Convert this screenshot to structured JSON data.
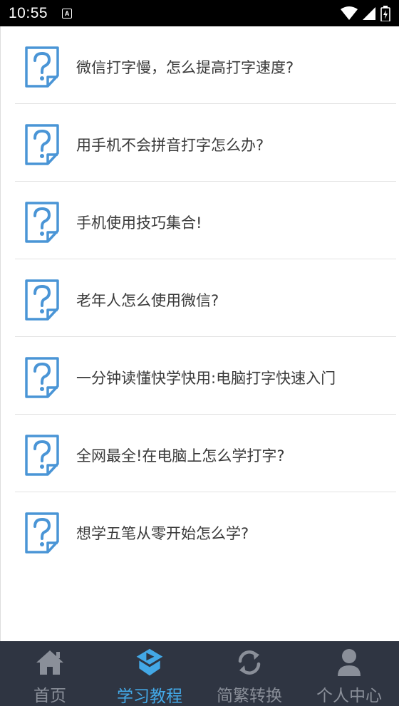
{
  "status_bar": {
    "time": "10:55",
    "notification_glyph": "A",
    "icons": [
      "wifi-icon",
      "cell-signal-icon",
      "battery-icon"
    ]
  },
  "list": {
    "items": [
      {
        "title": "微信打字慢，怎么提高打字速度?",
        "icon": "question-doc-icon"
      },
      {
        "title": "用手机不会拼音打字怎么办?",
        "icon": "question-doc-icon"
      },
      {
        "title": "手机使用技巧集合!",
        "icon": "question-doc-icon"
      },
      {
        "title": "老年人怎么使用微信?",
        "icon": "question-doc-icon"
      },
      {
        "title": "一分钟读懂快学快用:电脑打字快速入门",
        "icon": "question-doc-icon"
      },
      {
        "title": "全网最全!在电脑上怎么学打字?",
        "icon": "question-doc-icon"
      },
      {
        "title": "想学五笔从零开始怎么学?",
        "icon": "question-doc-icon"
      }
    ]
  },
  "tab_bar": {
    "tabs": [
      {
        "label": "首页",
        "icon": "home-icon",
        "active": false
      },
      {
        "label": "学习教程",
        "icon": "tutorial-icon",
        "active": true
      },
      {
        "label": "简繁转换",
        "icon": "convert-icon",
        "active": false
      },
      {
        "label": "个人中心",
        "icon": "person-icon",
        "active": false
      }
    ]
  },
  "colors": {
    "accent": "#43a8e6",
    "tab_bar_bg": "#2f3542",
    "inactive_tab": "#8a8f99",
    "icon_blue": "#4a95d6"
  }
}
